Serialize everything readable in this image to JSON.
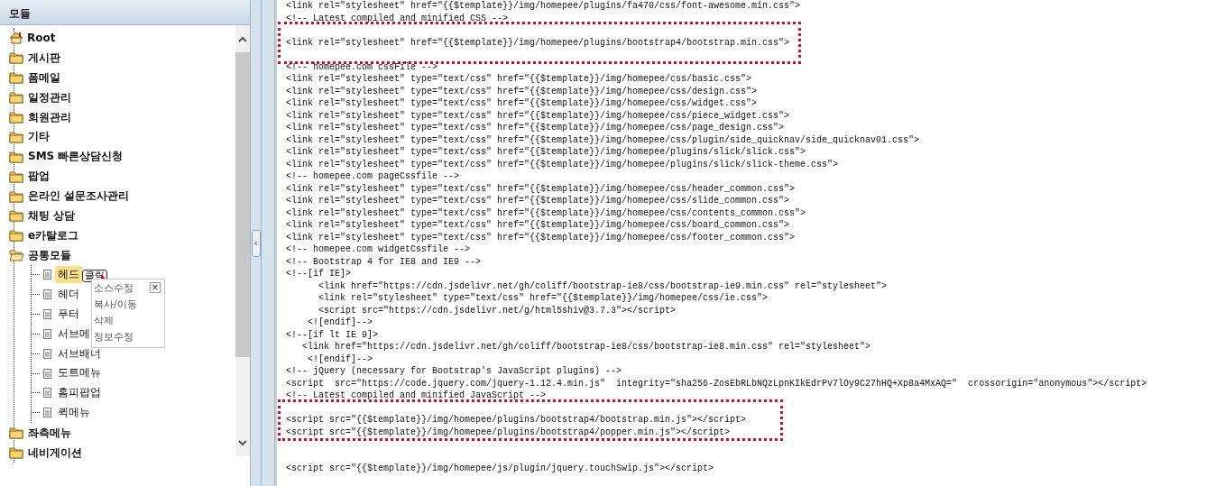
{
  "panel": {
    "title": "모듈"
  },
  "tree": [
    {
      "label": "Root",
      "kind": "root"
    },
    {
      "label": "게시판",
      "kind": "folder",
      "expanded": false
    },
    {
      "label": "폼메일",
      "kind": "folder",
      "expanded": false
    },
    {
      "label": "일정관리",
      "kind": "folder",
      "expanded": false
    },
    {
      "label": "회원관리",
      "kind": "folder",
      "expanded": false
    },
    {
      "label": "기타",
      "kind": "folder",
      "expanded": false
    },
    {
      "label": "SMS 빠른상담신청",
      "kind": "folder",
      "expanded": false
    },
    {
      "label": "팝업",
      "kind": "folder",
      "expanded": false
    },
    {
      "label": "온라인 설문조사관리",
      "kind": "folder",
      "expanded": false
    },
    {
      "label": "채팅 상담",
      "kind": "folder",
      "expanded": false
    },
    {
      "label": "e카탈로그",
      "kind": "folder",
      "expanded": false
    },
    {
      "label": "공통모듈",
      "kind": "folder",
      "expanded": true,
      "children": [
        {
          "label": "헤드",
          "selected": true
        },
        {
          "label": "헤더",
          "selected": false
        },
        {
          "label": "푸터",
          "selected": false
        },
        {
          "label": "서브메",
          "selected": false
        },
        {
          "label": "서브배너",
          "selected": false
        },
        {
          "label": "도트메뉴",
          "selected": false
        },
        {
          "label": "홈피팝업",
          "selected": false
        },
        {
          "label": "퀵메뉴",
          "selected": false
        }
      ]
    },
    {
      "label": "좌측메뉴",
      "kind": "folder",
      "expanded": false
    },
    {
      "label": "네비게이션",
      "kind": "folder",
      "expanded": false
    }
  ],
  "tooltip": {
    "text": "클릭"
  },
  "context_menu": {
    "close": "×",
    "items": [
      "소스수정",
      "복사/이동",
      "삭제",
      "정보수정"
    ]
  },
  "splitter": {
    "toggle": "‹"
  },
  "code": {
    "sections": [
      {
        "highlighted": false,
        "lines": [
          {
            "text": "<link rel=\"stylesheet\" href=\"{{$template}}/img/homepee/plugins/fa470/css/font-awesome.min.css\">"
          },
          {
            "text": "<!-- Latest compiled and minified CSS -->"
          }
        ]
      },
      {
        "highlighted": true,
        "lines": [
          {
            "kind": "blank"
          },
          {
            "text": "<link rel=\"stylesheet\" href=\"{{$template}}/img/homepee/plugins/bootstrap4/bootstrap.min.css\">"
          },
          {
            "kind": "blank"
          }
        ]
      },
      {
        "highlighted": false,
        "lines": [
          {
            "text": "<!-- homepee.com cssFile -->"
          },
          {
            "text": "<link rel=\"stylesheet\" type=\"text/css\" href=\"{{$template}}/img/homepee/css/basic.css\">"
          },
          {
            "text": "<link rel=\"stylesheet\" type=\"text/css\" href=\"{{$template}}/img/homepee/css/design.css\">"
          },
          {
            "text": "<link rel=\"stylesheet\" type=\"text/css\" href=\"{{$template}}/img/homepee/css/widget.css\">"
          },
          {
            "text": "<link rel=\"stylesheet\" type=\"text/css\" href=\"{{$template}}/img/homepee/css/piece_widget.css\">"
          },
          {
            "text": "<link rel=\"stylesheet\" type=\"text/css\" href=\"{{$template}}/img/homepee/css/page_design.css\">"
          },
          {
            "text": "<link rel=\"stylesheet\" type=\"text/css\" href=\"{{$template}}/img/homepee/css/plugin/side_quicknav/side_quicknav01.css\">"
          },
          {
            "text": "<link rel=\"stylesheet\" type=\"text/css\" href=\"{{$template}}/img/homepee/plugins/slick/slick.css\">"
          },
          {
            "text": "<link rel=\"stylesheet\" type=\"text/css\" href=\"{{$template}}/img/homepee/plugins/slick/slick-theme.css\">"
          },
          {
            "text": "<!-- homepee.com pageCssfile -->"
          },
          {
            "text": "<link rel=\"stylesheet\" type=\"text/css\" href=\"{{$template}}/img/homepee/css/header_common.css\">"
          },
          {
            "text": "<link rel=\"stylesheet\" type=\"text/css\" href=\"{{$template}}/img/homepee/css/slide_common.css\">"
          },
          {
            "text": "<link rel=\"stylesheet\" type=\"text/css\" href=\"{{$template}}/img/homepee/css/contents_common.css\">"
          },
          {
            "text": "<link rel=\"stylesheet\" type=\"text/css\" href=\"{{$template}}/img/homepee/css/board_common.css\">"
          },
          {
            "text": "<link rel=\"stylesheet\" type=\"text/css\" href=\"{{$template}}/img/homepee/css/footer_common.css\">"
          },
          {
            "text": "<!-- homepee.com widgetCssfile -->"
          },
          {
            "text": "<!-- Bootstrap 4 for IE8 and IE9 -->"
          },
          {
            "text": "<!--[if IE]>"
          },
          {
            "text": "      <link href=\"https://cdn.jsdelivr.net/gh/coliff/bootstrap-ie8/css/bootstrap-ie9.min.css\" rel=\"stylesheet\">"
          },
          {
            "text": "      <link rel=\"stylesheet\" type=\"text/css\" href=\"{{$template}}/img/homepee/css/ie.css\">"
          },
          {
            "text": "      <script src=\"https://cdn.jsdelivr.net/g/html5shiv@3.7.3\"></script>"
          },
          {
            "text": "    <![endif]-->"
          },
          {
            "text": "<!--[if lt IE 9]>"
          },
          {
            "text": "   <link href=\"https://cdn.jsdelivr.net/gh/coliff/bootstrap-ie8/css/bootstrap-ie8.min.css\" rel=\"stylesheet\">"
          },
          {
            "text": "    <![endif]-->"
          },
          {
            "text": "<!-- jQuery (necessary for Bootstrap's JavaScript plugins) -->"
          },
          {
            "text": "<script  src=\"https://code.jquery.com/jquery-1.12.4.min.js\"  integrity=\"sha256-ZosEbRLbNQzLpnKIkEdrPv7lOy9C27hHQ+Xp8a4MxAQ=\"  crossorigin=\"anonymous\"></script>"
          },
          {
            "text": "<!-- Latest compiled and minified JavaScript -->"
          }
        ]
      },
      {
        "highlighted": true,
        "lines": [
          {
            "kind": "blank"
          },
          {
            "text": "<script src=\"{{$template}}/img/homepee/plugins/bootstrap4/bootstrap.min.js\"></script>"
          },
          {
            "text": "<script src=\"{{$template}}/img/homepee/plugins/bootstrap4/popper.min.js\"></script>"
          }
        ]
      },
      {
        "highlighted": false,
        "lines": [
          {
            "kind": "blank"
          },
          {
            "kind": "blank"
          },
          {
            "text": "<script src=\"{{$template}}/img/homepee/js/plugin/jquery.touchSwip.js\"></script>"
          }
        ]
      }
    ]
  }
}
